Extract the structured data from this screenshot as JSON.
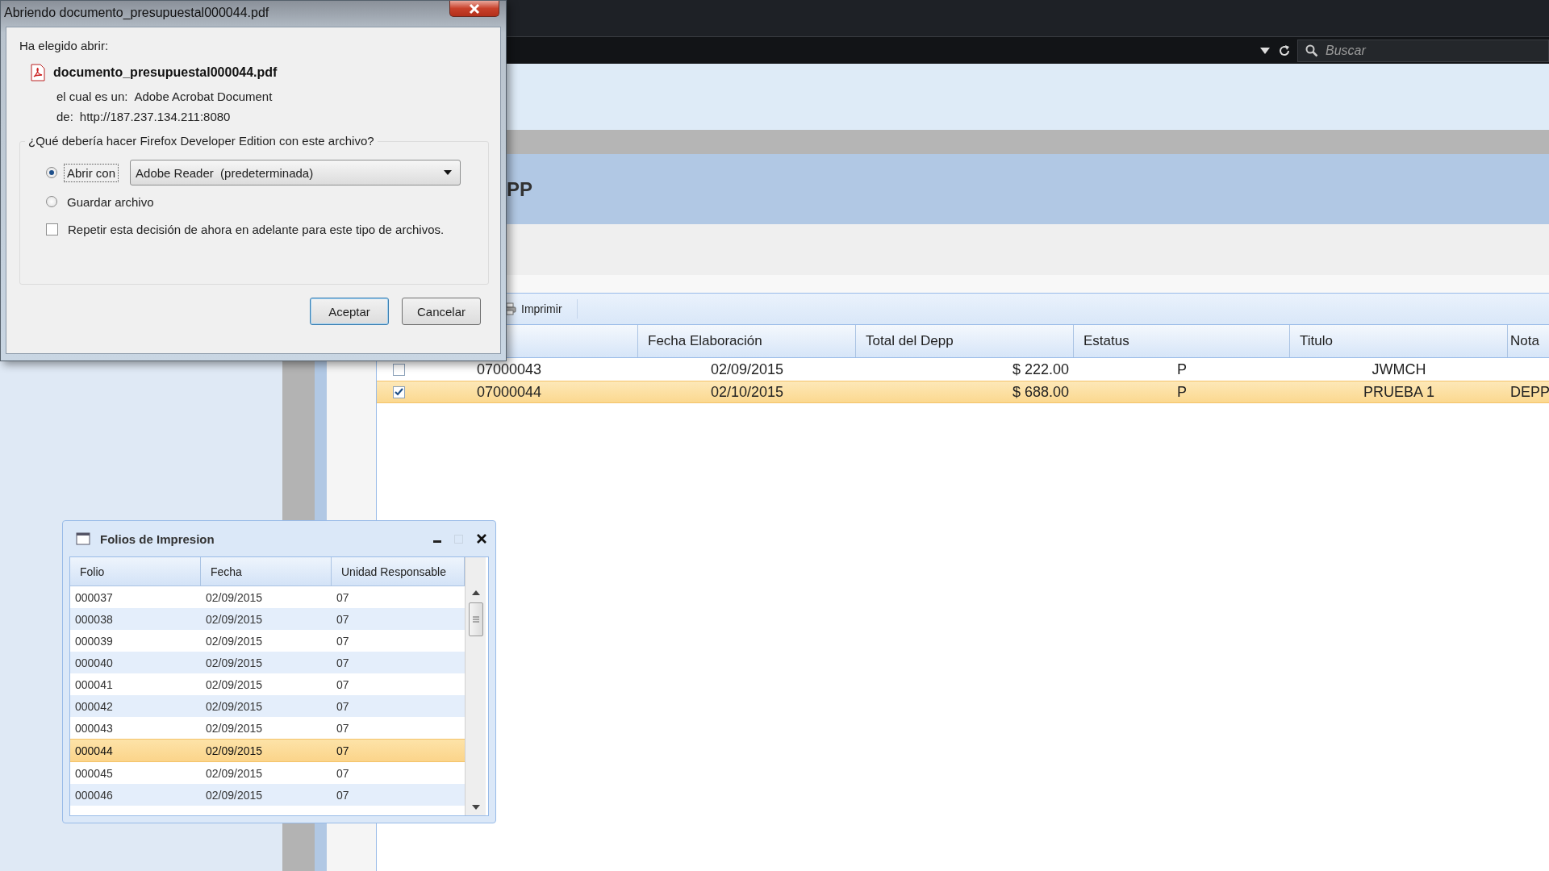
{
  "browser": {
    "search": {
      "placeholder": "Buscar"
    }
  },
  "page": {
    "title": "PP",
    "toolbar": [
      {
        "label": "Imprimir"
      }
    ],
    "grid": {
      "columns": [
        "Fecha Elaboración",
        "Total del Depp",
        "Estatus",
        "Titulo",
        "Nota"
      ],
      "rows": [
        {
          "checked": false,
          "selected": false,
          "folio": "07000043",
          "date": "02/09/2015",
          "total": "$ 222.00",
          "status": "P",
          "title": "JWMCH"
        },
        {
          "checked": true,
          "selected": true,
          "folio": "07000044",
          "date": "02/10/2015",
          "total": "$ 688.00",
          "status": "P",
          "title": "PRUEBA 1",
          "note": "DEPP"
        }
      ]
    }
  },
  "dialog": {
    "title": "Abriendo documento_presupuestal000044.pdf",
    "intro": "Ha elegido abrir:",
    "file_name": "documento_presupuestal000044.pdf",
    "type_label": "el cual es un:",
    "type_value": "Adobe Acrobat Document",
    "from_label": "de:",
    "from_value": "http://187.237.134.211:8080",
    "question": "¿Qué debería hacer Firefox Developer Edition con este archivo?",
    "options": [
      {
        "label": "Abrir con",
        "selected": true
      },
      {
        "label": "Guardar archivo",
        "selected": false
      }
    ],
    "app_select": {
      "value": "Adobe Reader  (predeterminada)"
    },
    "remember": {
      "label": "Repetir esta decisión de ahora en adelante para este tipo de archivos.",
      "checked": false
    },
    "buttons": [
      "Aceptar",
      "Cancelar"
    ]
  },
  "folios_window": {
    "title": "Folios de Impresion",
    "columns": [
      "Folio",
      "Fecha",
      "Unidad Responsable"
    ],
    "rows": [
      {
        "folio": "000037",
        "date": "02/09/2015",
        "unit": "07",
        "selected": false
      },
      {
        "folio": "000038",
        "date": "02/09/2015",
        "unit": "07",
        "selected": false
      },
      {
        "folio": "000039",
        "date": "02/09/2015",
        "unit": "07",
        "selected": false
      },
      {
        "folio": "000040",
        "date": "02/09/2015",
        "unit": "07",
        "selected": false
      },
      {
        "folio": "000041",
        "date": "02/09/2015",
        "unit": "07",
        "selected": false
      },
      {
        "folio": "000042",
        "date": "02/09/2015",
        "unit": "07",
        "selected": false
      },
      {
        "folio": "000043",
        "date": "02/09/2015",
        "unit": "07",
        "selected": false
      },
      {
        "folio": "000044",
        "date": "02/09/2015",
        "unit": "07",
        "selected": true
      },
      {
        "folio": "000045",
        "date": "02/09/2015",
        "unit": "07",
        "selected": false
      },
      {
        "folio": "000046",
        "date": "02/09/2015",
        "unit": "07",
        "selected": false
      }
    ]
  }
}
